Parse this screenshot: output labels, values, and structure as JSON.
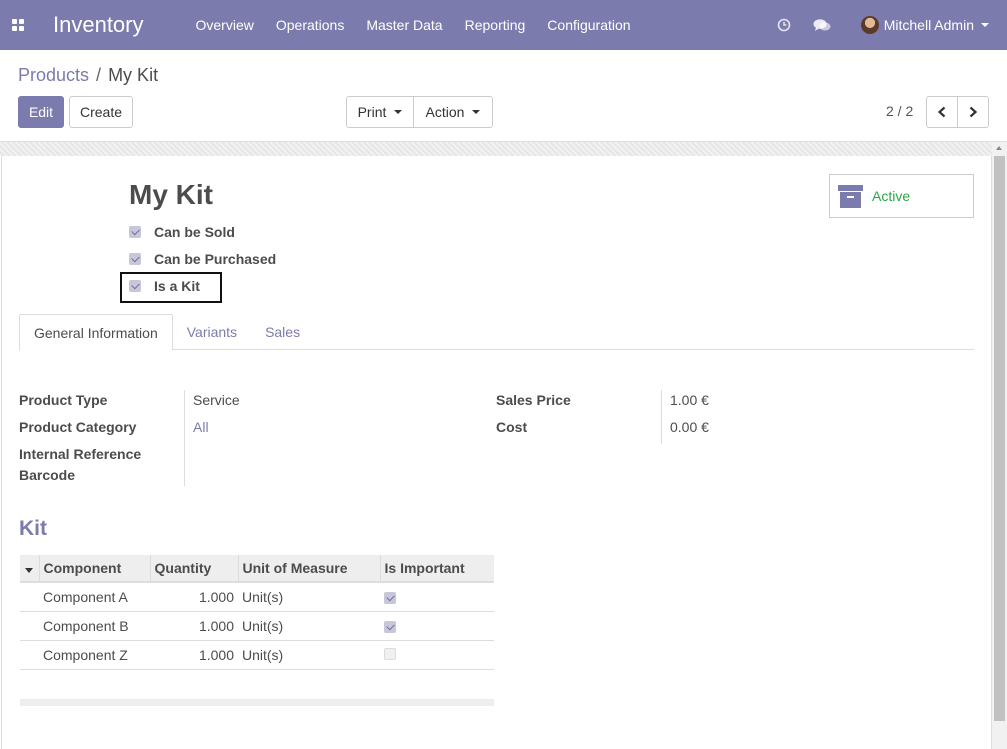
{
  "navbar": {
    "app_title": "Inventory",
    "menu": [
      "Overview",
      "Operations",
      "Master Data",
      "Reporting",
      "Configuration"
    ],
    "user_name": "Mitchell Admin",
    "icons": [
      "apps-grid-icon",
      "clock-icon",
      "chat-icon"
    ],
    "color": "#7c7bad"
  },
  "breadcrumb": {
    "parent": "Products",
    "separator": "/",
    "current": "My Kit"
  },
  "toolbar": {
    "edit_label": "Edit",
    "create_label": "Create",
    "print_label": "Print",
    "action_label": "Action"
  },
  "pager": {
    "value": "2 / 2"
  },
  "product": {
    "name": "My Kit",
    "checkboxes": [
      {
        "label": "Can be Sold",
        "checked": true
      },
      {
        "label": "Can be Purchased",
        "checked": true
      },
      {
        "label": "Is a Kit",
        "checked": true
      }
    ],
    "active_label": "Active"
  },
  "tabs": [
    "General Information",
    "Variants",
    "Sales"
  ],
  "general": {
    "left_labels": [
      "Product Type",
      "Product Category",
      "Internal Reference",
      "Barcode"
    ],
    "product_type": "Service",
    "product_category": "All",
    "right_labels": [
      "Sales Price",
      "Cost"
    ],
    "sales_price": "1.00 €",
    "cost": "0.00 €"
  },
  "kit": {
    "title": "Kit",
    "columns": [
      "Component",
      "Quantity",
      "Unit of Measure",
      "Is Important"
    ],
    "rows": [
      {
        "component": "Component A",
        "quantity": "1.000",
        "uom": "Unit(s)",
        "important": true
      },
      {
        "component": "Component B",
        "quantity": "1.000",
        "uom": "Unit(s)",
        "important": true
      },
      {
        "component": "Component Z",
        "quantity": "1.000",
        "uom": "Unit(s)",
        "important": false
      }
    ]
  }
}
